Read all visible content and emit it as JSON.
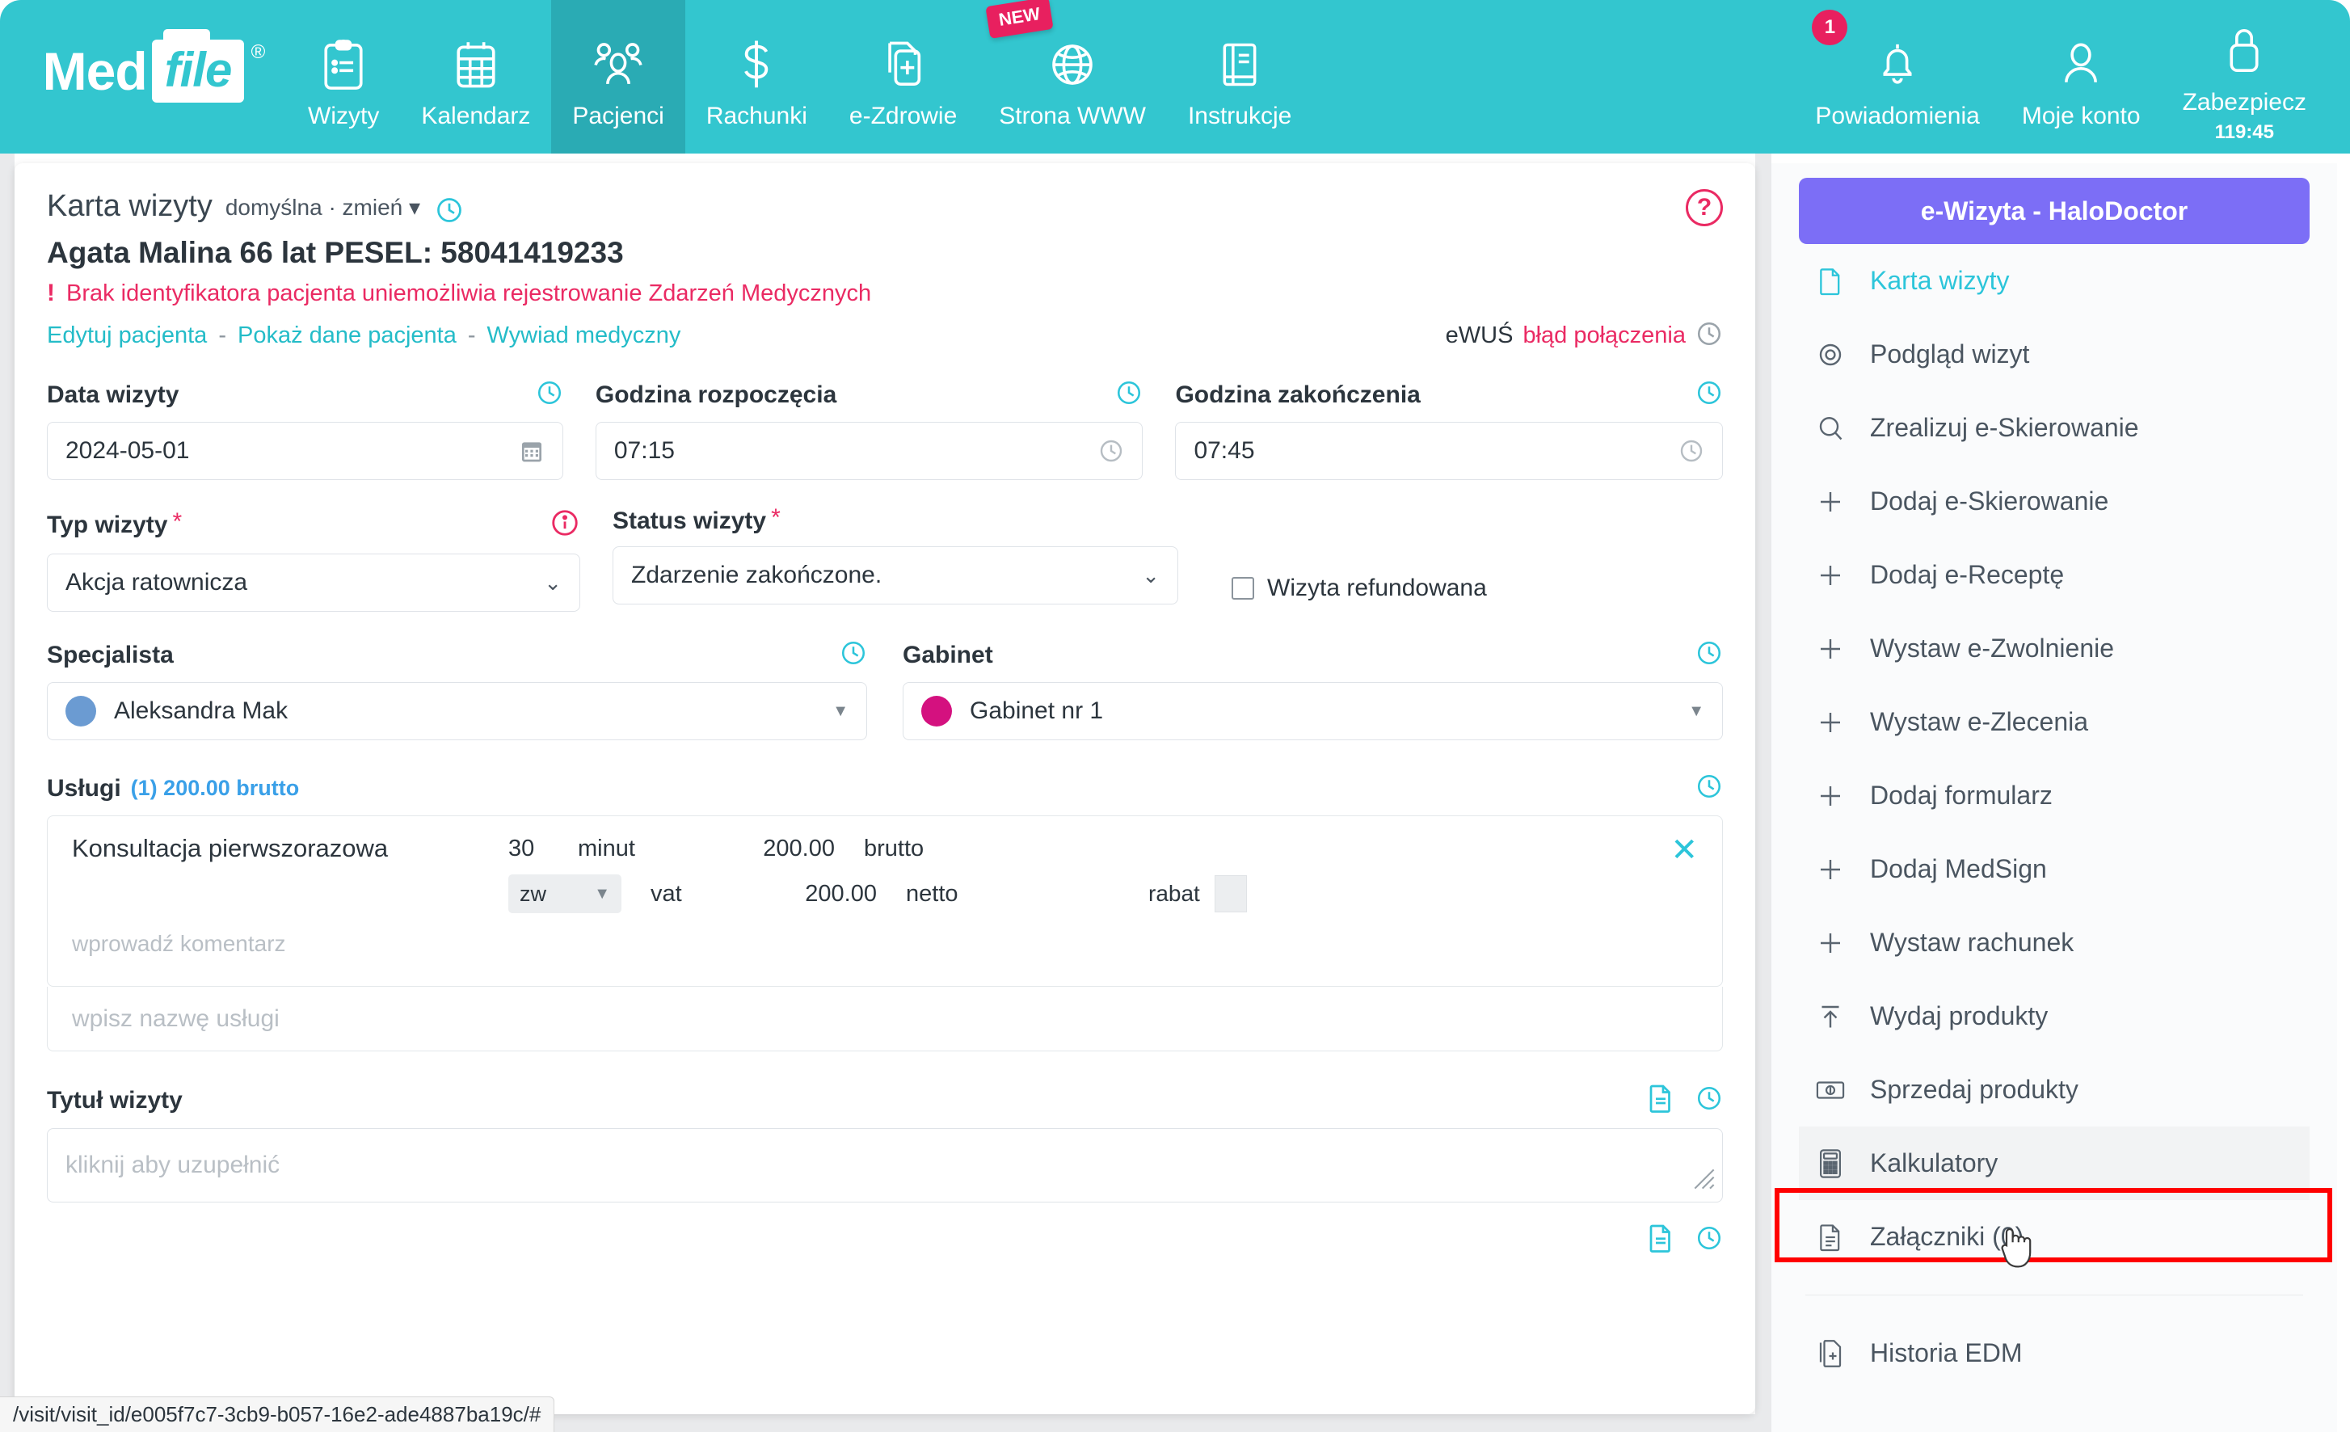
{
  "brand": {
    "logo_med": "Med",
    "logo_file": "file",
    "logo_reg": "®",
    "color": "#33c6cf"
  },
  "topnav": {
    "items": [
      {
        "label": "Wizyty",
        "icon": "clipboard-icon",
        "active": false
      },
      {
        "label": "Kalendarz",
        "icon": "calendar-icon",
        "active": false
      },
      {
        "label": "Pacjenci",
        "icon": "users-icon",
        "active": true
      },
      {
        "label": "Rachunki",
        "icon": "dollar-icon",
        "active": false
      },
      {
        "label": "e-Zdrowie",
        "icon": "medical-file-icon",
        "active": false
      },
      {
        "label": "Strona WWW",
        "icon": "globe-icon",
        "active": false,
        "badge": "NEW"
      },
      {
        "label": "Instrukcje",
        "icon": "book-icon",
        "active": false
      }
    ],
    "right_items": [
      {
        "label": "Powiadomienia",
        "icon": "bell-icon",
        "badge": "1"
      },
      {
        "label": "Moje konto",
        "icon": "user-icon"
      },
      {
        "label": "Zabezpiecz",
        "icon": "lock-icon",
        "sub": "119:45"
      }
    ],
    "badge_color": "#e8205f"
  },
  "card": {
    "title": "Karta wizyty",
    "template_label": "domyślna · zmień",
    "help_icon": "question-circle-icon",
    "patient": "Agata Malina 66 lat PESEL: 58041419233",
    "warning": "Brak identyfikatora pacjenta uniemożliwia rejestrowanie Zdarzeń Medycznych",
    "warning_mark": "!",
    "links": [
      "Edytuj pacjenta",
      "Pokaż dane pacjenta",
      "Wywiad medyczny"
    ],
    "link_separator": "-",
    "ewus_label": "eWUŚ",
    "ewus_status": "błąd połączenia",
    "warning_color": "#ea2a63",
    "link_color": "#24bcc8"
  },
  "form": {
    "date": {
      "label": "Data wizyty",
      "value": "2024-05-01",
      "trailing_icon": "calendar-icon",
      "header_icon": "history-clock-icon"
    },
    "start_time": {
      "label": "Godzina rozpoczęcia",
      "value": "07:15",
      "trailing_icon": "clock-icon",
      "header_icon": "history-clock-icon"
    },
    "end_time": {
      "label": "Godzina zakończenia",
      "value": "07:45",
      "trailing_icon": "clock-icon",
      "header_icon": "history-clock-icon"
    },
    "visit_type": {
      "label": "Typ wizyty",
      "required": "*",
      "value": "Akcja ratownicza",
      "info_icon": "info-circle-icon"
    },
    "visit_status": {
      "label": "Status wizyty",
      "required": "*",
      "value": "Zdarzenie zakończone."
    },
    "refunded": {
      "label": "Wizyta refundowana",
      "checked": false
    },
    "specialist": {
      "label": "Specjalista",
      "value": "Aleksandra Mak",
      "dot_color": "#6b9bd2",
      "header_icon": "history-clock-icon"
    },
    "room": {
      "label": "Gabinet",
      "value": "Gabinet nr 1",
      "dot_color": "#d4117f",
      "header_icon": "history-clock-icon"
    }
  },
  "services": {
    "title": "Usługi",
    "summary": "(1) 200.00 brutto",
    "summary_color": "#3aa0e8",
    "rows": [
      {
        "name": "Konsultacja pierwszorazowa",
        "duration": "30",
        "duration_unit": "minut",
        "gross_amount": "200.00",
        "gross_label": "brutto",
        "vat_value": "zw",
        "vat_label": "vat",
        "net_amount": "200.00",
        "net_label": "netto",
        "discount_label": "rabat",
        "comment_placeholder": "wprowadź komentarz",
        "remove_icon": "close-x-icon"
      }
    ],
    "add_placeholder": "wpisz nazwę usługi"
  },
  "visit_title": {
    "label": "Tytuł wizyty",
    "placeholder": "kliknij aby uzupełnić",
    "icons": [
      "document-icon",
      "history-clock-icon"
    ]
  },
  "bottom_icons": [
    "document-icon",
    "history-clock-icon"
  ],
  "sidebar": {
    "ewizyta_button": "e-Wizyta - HaloDoctor",
    "ewizyta_color": "#7c6ef6",
    "items": [
      {
        "label": "Karta wizyty",
        "icon": "document-icon",
        "active": true
      },
      {
        "label": "Podgląd wizyt",
        "icon": "eye-icon",
        "active": false
      },
      {
        "label": "Zrealizuj e-Skierowanie",
        "icon": "search-icon",
        "active": false
      },
      {
        "label": "Dodaj e-Skierowanie",
        "icon": "plus-icon",
        "active": false
      },
      {
        "label": "Dodaj e-Receptę",
        "icon": "plus-icon",
        "active": false
      },
      {
        "label": "Wystaw e-Zwolnienie",
        "icon": "plus-icon",
        "active": false
      },
      {
        "label": "Wystaw e-Zlecenia",
        "icon": "plus-icon",
        "active": false
      },
      {
        "label": "Dodaj formularz",
        "icon": "plus-icon",
        "active": false
      },
      {
        "label": "Dodaj MedSign",
        "icon": "plus-icon",
        "active": false
      },
      {
        "label": "Wystaw rachunek",
        "icon": "plus-icon",
        "active": false
      },
      {
        "label": "Wydaj produkty",
        "icon": "upload-arrow-icon",
        "active": false
      },
      {
        "label": "Sprzedaj produkty",
        "icon": "banknote-icon",
        "active": false
      },
      {
        "label": "Kalkulatory",
        "icon": "calculator-icon",
        "active": false,
        "hovered": true,
        "highlighted": true
      },
      {
        "label": "Załączniki (0)",
        "icon": "file-lines-icon",
        "active": false
      }
    ],
    "footer_items": [
      {
        "label": "Historia EDM",
        "icon": "file-add-icon"
      }
    ],
    "highlight_color": "#ff0000"
  },
  "statusbar": {
    "url": "/visit/visit_id/e005f7c7-3cb9-b057-16e2-ade4887ba19c/#"
  }
}
